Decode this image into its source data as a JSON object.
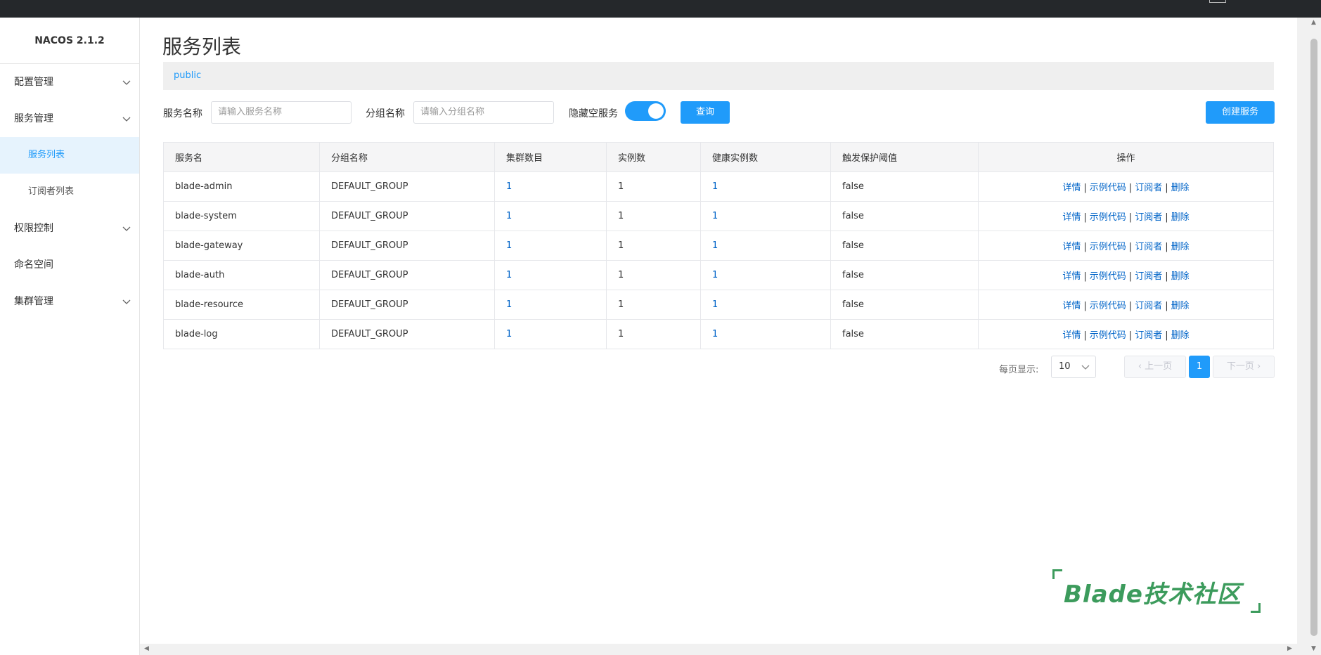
{
  "app": {
    "logo": "NACOS 2.1.2"
  },
  "sidebar": {
    "items": [
      {
        "label": "配置管理"
      },
      {
        "label": "服务管理"
      },
      {
        "label": "服务列表"
      },
      {
        "label": "订阅者列表"
      },
      {
        "label": "权限控制"
      },
      {
        "label": "命名空间"
      },
      {
        "label": "集群管理"
      }
    ]
  },
  "main": {
    "title": "服务列表",
    "namespace": "public",
    "filters": {
      "service_name_label": "服务名称",
      "service_name_placeholder": "请输入服务名称",
      "group_name_label": "分组名称",
      "group_name_placeholder": "请输入分组名称",
      "hide_empty_label": "隐藏空服务",
      "hide_empty_on": true,
      "query_label": "查询",
      "create_label": "创建服务"
    },
    "table": {
      "headers": [
        "服务名",
        "分组名称",
        "集群数目",
        "实例数",
        "健康实例数",
        "触发保护阈值",
        "操作"
      ],
      "rows": [
        {
          "name": "blade-admin",
          "group": "DEFAULT_GROUP",
          "clusters": "1",
          "instances": "1",
          "healthy": "1",
          "protect": "false"
        },
        {
          "name": "blade-system",
          "group": "DEFAULT_GROUP",
          "clusters": "1",
          "instances": "1",
          "healthy": "1",
          "protect": "false"
        },
        {
          "name": "blade-gateway",
          "group": "DEFAULT_GROUP",
          "clusters": "1",
          "instances": "1",
          "healthy": "1",
          "protect": "false"
        },
        {
          "name": "blade-auth",
          "group": "DEFAULT_GROUP",
          "clusters": "1",
          "instances": "1",
          "healthy": "1",
          "protect": "false"
        },
        {
          "name": "blade-resource",
          "group": "DEFAULT_GROUP",
          "clusters": "1",
          "instances": "1",
          "healthy": "1",
          "protect": "false"
        },
        {
          "name": "blade-log",
          "group": "DEFAULT_GROUP",
          "clusters": "1",
          "instances": "1",
          "healthy": "1",
          "protect": "false"
        }
      ],
      "ops": {
        "detail": "详情",
        "sample": "示例代码",
        "subscribers": "订阅者",
        "delete": "删除",
        "sep": "|"
      }
    },
    "pagination": {
      "page_size_label": "每页显示:",
      "page_size": "10",
      "prev": "上一页",
      "current": "1",
      "next": "下一页"
    },
    "watermark": "Blade技术社区"
  },
  "colors": {
    "accent": "#209bfa",
    "link": "#0064c8",
    "topbar": "#25282b",
    "watermark": "#3c9b5c"
  }
}
